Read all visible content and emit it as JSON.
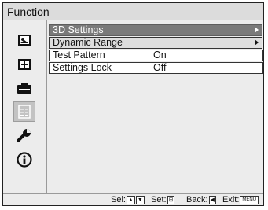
{
  "menu": {
    "title": "Function"
  },
  "sidebar": {
    "items": [
      {
        "icon": "picture-icon",
        "selected": false
      },
      {
        "icon": "screen-icon",
        "selected": false
      },
      {
        "icon": "projector-icon",
        "selected": false
      },
      {
        "icon": "function-icon",
        "selected": true
      },
      {
        "icon": "wrench-icon",
        "selected": false
      },
      {
        "icon": "info-icon",
        "selected": false
      }
    ]
  },
  "rows": [
    {
      "label": "3D Settings",
      "value": "",
      "state": "highlighted"
    },
    {
      "label": "Dynamic Range",
      "value": "",
      "state": "submenu"
    },
    {
      "label": "Test Pattern",
      "value": "On",
      "state": "value"
    },
    {
      "label": "Settings Lock",
      "value": "Off",
      "state": "value"
    }
  ],
  "status": {
    "sel_label": "Sel:",
    "set_label": "Set:",
    "back_label": "Back:",
    "exit_label": "Exit:",
    "exit_key": "MENU"
  },
  "colors": {
    "highlight": "#7a7a7a",
    "background": "#ececec",
    "title_bar": "#dcdcdc"
  }
}
